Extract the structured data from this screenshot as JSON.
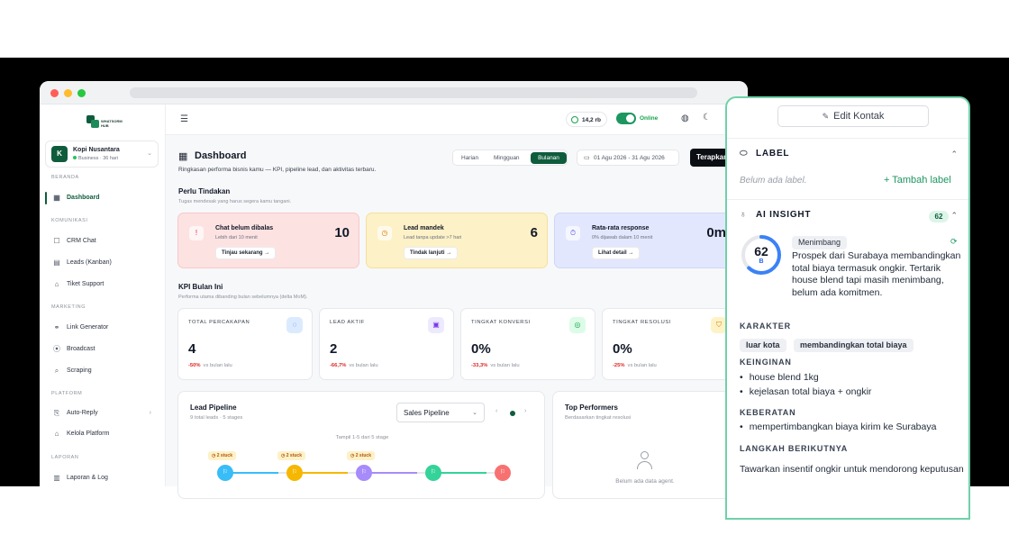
{
  "sidebar": {
    "logo_text": "WHATSORM HUB",
    "business": {
      "avatar": "K",
      "name": "Kopi Nusantara",
      "sub": "Business · 36 hari"
    },
    "sections": [
      {
        "label": "BERANDA",
        "items": [
          {
            "label": "Dashboard",
            "icon": "dashboard-icon",
            "active": true
          }
        ]
      },
      {
        "label": "KOMUNIKASI",
        "items": [
          {
            "label": "CRM Chat",
            "icon": "chat-icon"
          },
          {
            "label": "Leads (Kanban)",
            "icon": "kanban-icon"
          },
          {
            "label": "Tiket Support",
            "icon": "ticket-icon"
          }
        ]
      },
      {
        "label": "MARKETING",
        "items": [
          {
            "label": "Link Generator",
            "icon": "link-icon"
          },
          {
            "label": "Broadcast",
            "icon": "broadcast-icon"
          },
          {
            "label": "Scraping",
            "icon": "search-icon"
          }
        ]
      },
      {
        "label": "PLATFORM",
        "items": [
          {
            "label": "Auto-Reply",
            "icon": "auto-reply-icon"
          },
          {
            "label": "Kelola Platform",
            "icon": "platform-icon"
          }
        ]
      },
      {
        "label": "LAPORAN",
        "items": [
          {
            "label": "Laporan & Log",
            "icon": "report-icon"
          }
        ]
      }
    ]
  },
  "topbar": {
    "credit": "14,2 rb",
    "status": "Online"
  },
  "dashboard": {
    "title": "Dashboard",
    "subtitle": "Ringkasan performa bisnis kamu — KPI, pipeline lead, dan aktivitas terbaru.",
    "periods": [
      "Harian",
      "Mingguan",
      "Bulanan"
    ],
    "active_period": "Bulanan",
    "date_range": "01 Agu 2026 - 31 Agu 2026",
    "apply_label": "Terapkan"
  },
  "action": {
    "title": "Perlu Tindakan",
    "subtitle": "Tugas mendesak yang harus segera kamu tangani.",
    "cards": [
      {
        "title": "Chat belum dibalas",
        "sub": "Lebih dari 10 menit",
        "value": "10",
        "button": "Tinjau sekarang →",
        "icon": "alert-icon",
        "color": "#e11d48"
      },
      {
        "title": "Lead mandek",
        "sub": "Lead tanpa update >7 hari",
        "value": "6",
        "button": "Tindak lanjuti →",
        "icon": "clock-icon",
        "color": "#d97706"
      },
      {
        "title": "Rata-rata response",
        "sub": "0% dijawab dalam 10 menit",
        "value": "0m",
        "button": "Lihat detail →",
        "icon": "timer-icon",
        "color": "#4f46e5"
      }
    ]
  },
  "kpi": {
    "title": "KPI Bulan Ini",
    "subtitle": "Performa utama dibanding bulan sebelumnya (delta MoM).",
    "cards": [
      {
        "label": "TOTAL PERCAKAPAN",
        "value": "4",
        "delta": "-50%",
        "note": "vs bulan lalu",
        "icon": "message-icon",
        "bg": "#dbeafe",
        "fg": "#2563eb"
      },
      {
        "label": "LEAD AKTIF",
        "value": "2",
        "delta": "-66,7%",
        "note": "vs bulan lalu",
        "icon": "id-card-icon",
        "bg": "#ede9fe",
        "fg": "#7c3aed"
      },
      {
        "label": "TINGKAT KONVERSI",
        "value": "0%",
        "delta": "-33,3%",
        "note": "vs bulan lalu",
        "icon": "target-icon",
        "bg": "#dcfce7",
        "fg": "#16a34a"
      },
      {
        "label": "TINGKAT RESOLUSI",
        "value": "0%",
        "delta": "-25%",
        "note": "vs bulan lalu",
        "icon": "shield-icon",
        "bg": "#fef3c7",
        "fg": "#d97706"
      }
    ]
  },
  "pipeline": {
    "title": "Lead Pipeline",
    "subtitle": "9 total leads · 5 stages",
    "select_value": "Sales Pipeline",
    "showing": "Tampil 1-5 dari 5 stage",
    "stuck_label": "2 stuck",
    "stages": [
      {
        "color": "#38bdf8",
        "stuck": true
      },
      {
        "color": "#f5b700",
        "stuck": true
      },
      {
        "color": "#a78bfa",
        "stuck": true
      },
      {
        "color": "#34d399",
        "stuck": false
      },
      {
        "color": "#f87171",
        "stuck": false
      }
    ]
  },
  "performers": {
    "title": "Top Performers",
    "subtitle": "Berdasarkan tingkat resolusi",
    "empty": "Belum ada data agent."
  },
  "contact_panel": {
    "edit_button": "Edit Kontak",
    "label_section": {
      "title": "LABEL",
      "empty": "Belum ada label.",
      "add": "+  Tambah label"
    },
    "insight": {
      "title": "AI INSIGHT",
      "score": "62",
      "grade": "B",
      "score_fraction": 0.62,
      "status": "Menimbang",
      "summary": "Prospek dari Surabaya membandingkan total biaya termasuk ongkir. Tertarik house blend tapi masih menimbang, belum ada komitmen.",
      "karakter_label": "KARAKTER",
      "karakter": [
        "luar kota",
        "membandingkan total biaya"
      ],
      "keinginan_label": "KEINGINAN",
      "keinginan": [
        "house blend 1kg",
        "kejelasan total biaya + ongkir"
      ],
      "keberatan_label": "KEBERATAN",
      "keberatan": [
        "mempertimbangkan biaya kirim ke Surabaya"
      ],
      "next_label": "LANGKAH BERIKUTNYA",
      "next": "Tawarkan insentif ongkir untuk mendorong keputusan"
    }
  }
}
